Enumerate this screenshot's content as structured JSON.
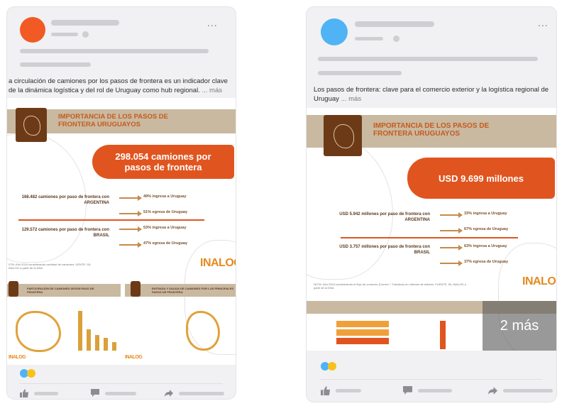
{
  "posts": [
    {
      "more_icon": "...",
      "caption": "a circulación de camiones por los pasos de frontera es un indicador clave de la dinámica logística y del rol de Uruguay como hub regional.",
      "caption_more": "... más",
      "infographic": {
        "title": "IMPORTANCIA DE LOS PASOS DE FRONTERA URUGUAYOS",
        "highlight": "298.054 camiones por pasos de frontera",
        "argentina_label": "168.482 camiones por paso de frontera con ARGENTINA",
        "argentina_in": "49% ingresa a Uruguay",
        "argentina_out": "51% egresa de Uruguay",
        "brasil_label": "129.572 camiones por paso de frontera con BRASIL",
        "brasil_in": "53% ingresa a Uruguay",
        "brasil_out": "47% egresa de Uruguay",
        "note": "OTA: Año 2024 considerando cantidad de camiones. UENTE: SIL INALOG a partir de la DNA",
        "logo": "INALOG",
        "panel1_title": "PARTICIPACIÓN DE CAMIONES SEGÚN PASO DE FRONTERA",
        "panel2_title": "ENTRADA Y SALIDA DE CAMIONES POR LOS PRINCIPALES PASOS DE FRONTERA",
        "panel_logo": "INALOG",
        "bottom_logo": "INALOG"
      }
    },
    {
      "more_icon": "...",
      "caption": "Los pasos de frontera: clave para el comercio exterior y la logística regional de Uruguay",
      "caption_more": "... más",
      "infographic": {
        "title": "IMPORTANCIA DE LOS PASOS DE FRONTERA URUGUAYOS",
        "highlight": "USD 9.699 millones",
        "argentina_label": "USD 5.942 millones por paso de frontera con ARGENTINA",
        "argentina_in": "33% ingresa a Uruguay",
        "argentina_out": "67% egresa de Uruguay",
        "brasil_label": "USD 3.757 millones por paso de frontera con BRASIL",
        "brasil_in": "63% ingresa a Uruguay",
        "brasil_out": "37% egresa de Uruguay",
        "note": "NOTA: Año 2024 considerando el flujo de comercio (Comex + Tránsitos) en millones de dólares. FUENTE: SIL INALOG a partir de la DNA",
        "logo": "INALOG",
        "more_photos": "2 más"
      }
    }
  ],
  "colors": {
    "avatar_left": "#f15a24",
    "avatar_right": "#4fb3f5",
    "accent": "#e0551f",
    "band": "#c9b9a0"
  }
}
